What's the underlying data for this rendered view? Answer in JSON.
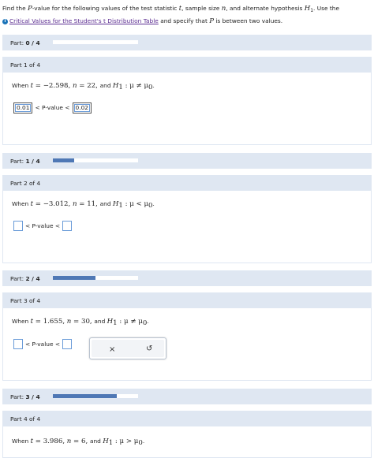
{
  "intro": {
    "t1": "Find the ",
    "P": "P",
    "t2": "-value for the following values of the test statistic ",
    "t": "t",
    "t3": ", sample size ",
    "n": "n",
    "t4": ", and alternate hypothesis ",
    "H": "H",
    "Hsub": "1",
    "t5": ". Use the",
    "link": "Critical Values for the Student's t Distribution Table",
    "t6": " and specify that ",
    "P2": "P",
    "t7": " is between two values."
  },
  "progress": [
    {
      "label": "Part:",
      "value": "0 / 4",
      "fraction": 0.0
    },
    {
      "label": "Part:",
      "value": "1 / 4",
      "fraction": 0.25
    },
    {
      "label": "Part:",
      "value": "2 / 4",
      "fraction": 0.5
    },
    {
      "label": "Part:",
      "value": "3 / 4",
      "fraction": 0.75
    }
  ],
  "parts": [
    {
      "title": "Part 1 of 4",
      "when": "When ",
      "t": "t",
      "tval": " = −2.598, ",
      "n": "n",
      "nval": " = 22, ",
      "and": "and ",
      "H": "H",
      "sub": "1",
      "hyp": " : μ ≠ μ",
      "hsub": "0",
      "dot": ".",
      "lower": "0.01",
      "pvalue": "< P-value <",
      "upper": "0.02"
    },
    {
      "title": "Part 2 of 4",
      "when": "When ",
      "t": "t",
      "tval": " = −3.012, ",
      "n": "n",
      "nval": " = 11, ",
      "and": "and ",
      "H": "H",
      "sub": "1",
      "hyp": " : μ < μ",
      "hsub": "0",
      "dot": ".",
      "lower": "",
      "pvalue": "< P-value <",
      "upper": ""
    },
    {
      "title": "Part 3 of 4",
      "when": "When ",
      "t": "t",
      "tval": " = 1.655, ",
      "n": "n",
      "nval": " = 30, ",
      "and": "and ",
      "H": "H",
      "sub": "1",
      "hyp": " : μ ≠ μ",
      "hsub": "0",
      "dot": ".",
      "lower": "",
      "pvalue": "< P-value <",
      "upper": ""
    },
    {
      "title": "Part 4 of 4",
      "when": "When ",
      "t": "t",
      "tval": " = 3.986, ",
      "n": "n",
      "nval": " = 6, ",
      "and": "and ",
      "H": "H",
      "sub": "1",
      "hyp": " : μ > μ",
      "hsub": "0",
      "dot": "."
    }
  ],
  "popup": {
    "clear_icon": "×",
    "undo_icon": "↺"
  },
  "icons": {
    "info": "info-icon",
    "clear": "close-icon",
    "undo": "undo-icon"
  },
  "colors": {
    "accent": "#4f78b5",
    "header_bg": "#dfe7f2",
    "link": "#5c2d91",
    "input_border": "#6a9bd8"
  }
}
